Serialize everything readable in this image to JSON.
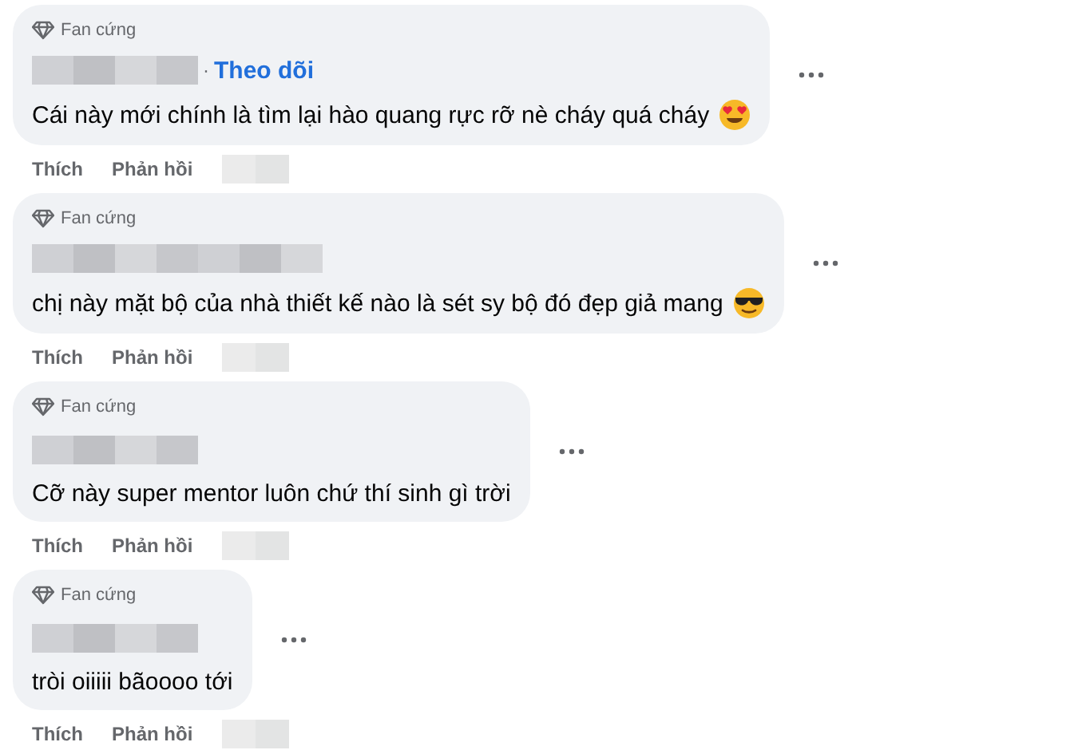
{
  "comments": [
    {
      "badge": "Fan cứng",
      "follow": {
        "separator": "·",
        "label": "Theo dõi"
      },
      "text": "Cái này mới chính là tìm lại hào quang rực rỡ nè cháy quá cháy",
      "emoji": {
        "kind": "heart_eyes"
      },
      "actions": [
        "Thích",
        "Phản hồi"
      ]
    },
    {
      "badge": "Fan cứng",
      "text": "chị này mặt bộ của nhà thiết kế nào là sét sy bộ đó đẹp giả mang",
      "emoji": {
        "kind": "sunglasses"
      },
      "actions": [
        "Thích",
        "Phản hồi"
      ]
    },
    {
      "badge": "Fan cứng",
      "text": "Cỡ này super mentor luôn chứ thí sinh gì trời",
      "actions": [
        "Thích",
        "Phản hồi"
      ]
    },
    {
      "badge": "Fan cứng",
      "text": "tròi oiiiii bãoooo tới",
      "actions": [
        "Thích",
        "Phản hồi"
      ]
    }
  ]
}
